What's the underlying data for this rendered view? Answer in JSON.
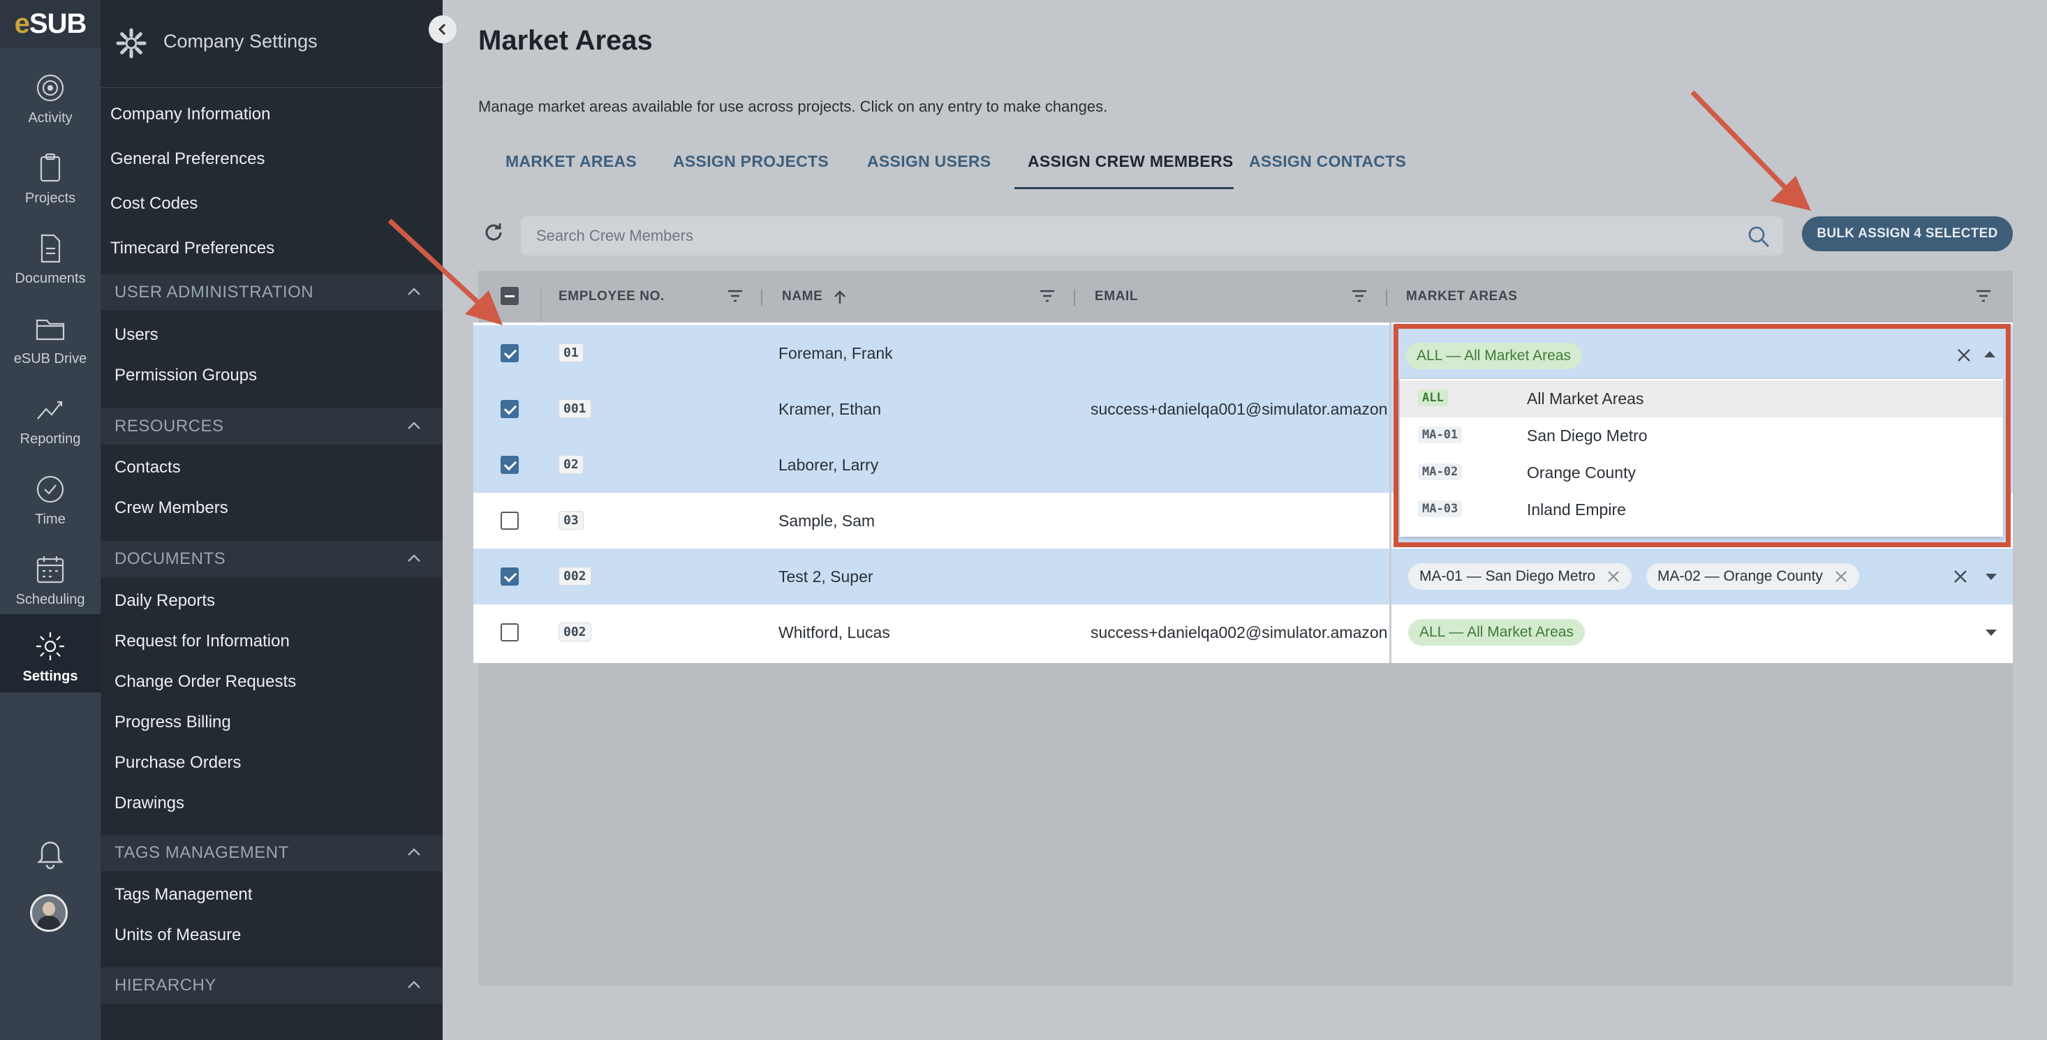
{
  "app": {
    "logo_prefix": "e",
    "logo_suffix": "SUB"
  },
  "rail": {
    "items": [
      {
        "label": "Activity",
        "icon": "activity-icon"
      },
      {
        "label": "Projects",
        "icon": "clipboard-icon"
      },
      {
        "label": "Documents",
        "icon": "document-icon"
      },
      {
        "label": "eSUB Drive",
        "icon": "folder-icon"
      },
      {
        "label": "Reporting",
        "icon": "chart-icon"
      },
      {
        "label": "Time",
        "icon": "clock-icon"
      },
      {
        "label": "Scheduling",
        "icon": "calendar-icon"
      },
      {
        "label": "Settings",
        "icon": "gear-icon"
      }
    ]
  },
  "menu": {
    "title": "Company Settings",
    "top_links": [
      "Company Information",
      "General Preferences",
      "Cost Codes",
      "Timecard Preferences"
    ],
    "sections": [
      {
        "title": "USER ADMINISTRATION",
        "items": [
          "Users",
          "Permission Groups"
        ]
      },
      {
        "title": "RESOURCES",
        "items": [
          "Contacts",
          "Crew Members"
        ]
      },
      {
        "title": "DOCUMENTS",
        "items": [
          "Daily Reports",
          "Request for Information",
          "Change Order Requests",
          "Progress Billing",
          "Purchase Orders",
          "Drawings"
        ]
      },
      {
        "title": "TAGS MANAGEMENT",
        "items": [
          "Tags Management",
          "Units of Measure"
        ]
      },
      {
        "title": "HIERARCHY",
        "items": []
      }
    ]
  },
  "main": {
    "title": "Market Areas",
    "description": "Manage market areas available for use across projects. Click on any entry to make changes.",
    "tabs": [
      "MARKET AREAS",
      "ASSIGN PROJECTS",
      "ASSIGN USERS",
      "ASSIGN CREW MEMBERS",
      "ASSIGN CONTACTS"
    ],
    "active_tab": "ASSIGN CREW MEMBERS",
    "search_placeholder": "Search Crew Members",
    "bulk_button": "BULK ASSIGN 4 SELECTED",
    "columns": [
      "EMPLOYEE NO.",
      "NAME",
      "EMAIL",
      "MARKET AREAS"
    ],
    "rows": [
      {
        "selected": true,
        "emp_no": "01",
        "name": "Foreman, Frank",
        "email": "",
        "market_areas": [
          "ALL — All Market Areas"
        ]
      },
      {
        "selected": true,
        "emp_no": "001",
        "name": "Kramer, Ethan",
        "email": "success+danielqa001@simulator.amazon",
        "market_areas": []
      },
      {
        "selected": true,
        "emp_no": "02",
        "name": "Laborer, Larry",
        "email": "",
        "market_areas": []
      },
      {
        "selected": false,
        "emp_no": "03",
        "name": "Sample, Sam",
        "email": "",
        "market_areas": []
      },
      {
        "selected": true,
        "emp_no": "002",
        "name": "Test 2, Super",
        "email": "",
        "market_areas": [
          "MA-01 — San Diego Metro",
          "MA-02 — Orange County"
        ]
      },
      {
        "selected": false,
        "emp_no": "002",
        "name": "Whitford, Lucas",
        "email": "success+danielqa002@simulator.amazon",
        "market_areas": [
          "ALL — All Market Areas"
        ]
      }
    ],
    "dropdown": {
      "options": [
        {
          "code": "ALL",
          "label": "All Market Areas"
        },
        {
          "code": "MA-01",
          "label": "San Diego Metro"
        },
        {
          "code": "MA-02",
          "label": "Orange County"
        },
        {
          "code": "MA-03",
          "label": "Inland Empire"
        }
      ]
    }
  },
  "colors": {
    "accent": "#3e5d78",
    "selected_row": "#c9ddf3",
    "highlight_frame": "#d1533b",
    "annotation_arrow": "#d05a45",
    "chip_green": "#d4ebcf"
  }
}
